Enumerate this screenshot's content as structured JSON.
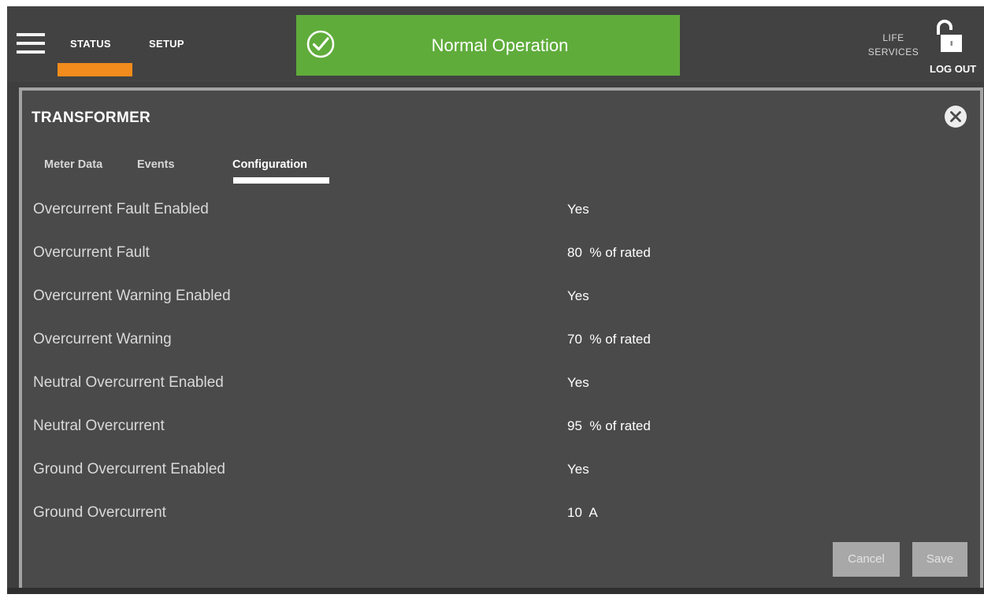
{
  "topbar": {
    "nav_tabs": [
      {
        "label": "STATUS",
        "active": true
      },
      {
        "label": "SETUP",
        "active": false
      }
    ],
    "active_accent_color": "#f28c1c",
    "banner": {
      "text": "Normal Operation",
      "icon": "check-circle-icon",
      "color": "#5fac3b"
    },
    "life_services": {
      "line1": "LIFE",
      "line2": "SERVICES"
    },
    "logout": {
      "label": "LOG OUT",
      "icon": "unlocked-padlock-icon"
    }
  },
  "dialog": {
    "title": "TRANSFORMER",
    "close_icon": "close-circle-icon",
    "tabs": [
      {
        "label": "Meter Data",
        "active": false
      },
      {
        "label": "Events",
        "active": false
      },
      {
        "label": "Configuration",
        "active": true
      }
    ],
    "rows": [
      {
        "label": "Overcurrent Fault Enabled",
        "value": "Yes"
      },
      {
        "label": "Overcurrent Fault",
        "value": "80  % of rated"
      },
      {
        "label": "Overcurrent Warning Enabled",
        "value": "Yes"
      },
      {
        "label": "Overcurrent Warning",
        "value": "70  % of rated"
      },
      {
        "label": "Neutral Overcurrent Enabled",
        "value": "Yes"
      },
      {
        "label": "Neutral Overcurrent",
        "value": "95  % of rated"
      },
      {
        "label": "Ground Overcurrent Enabled",
        "value": "Yes"
      },
      {
        "label": "Ground Overcurrent",
        "value": "10  A"
      }
    ],
    "buttons": {
      "cancel": "Cancel",
      "save": "Save"
    }
  }
}
